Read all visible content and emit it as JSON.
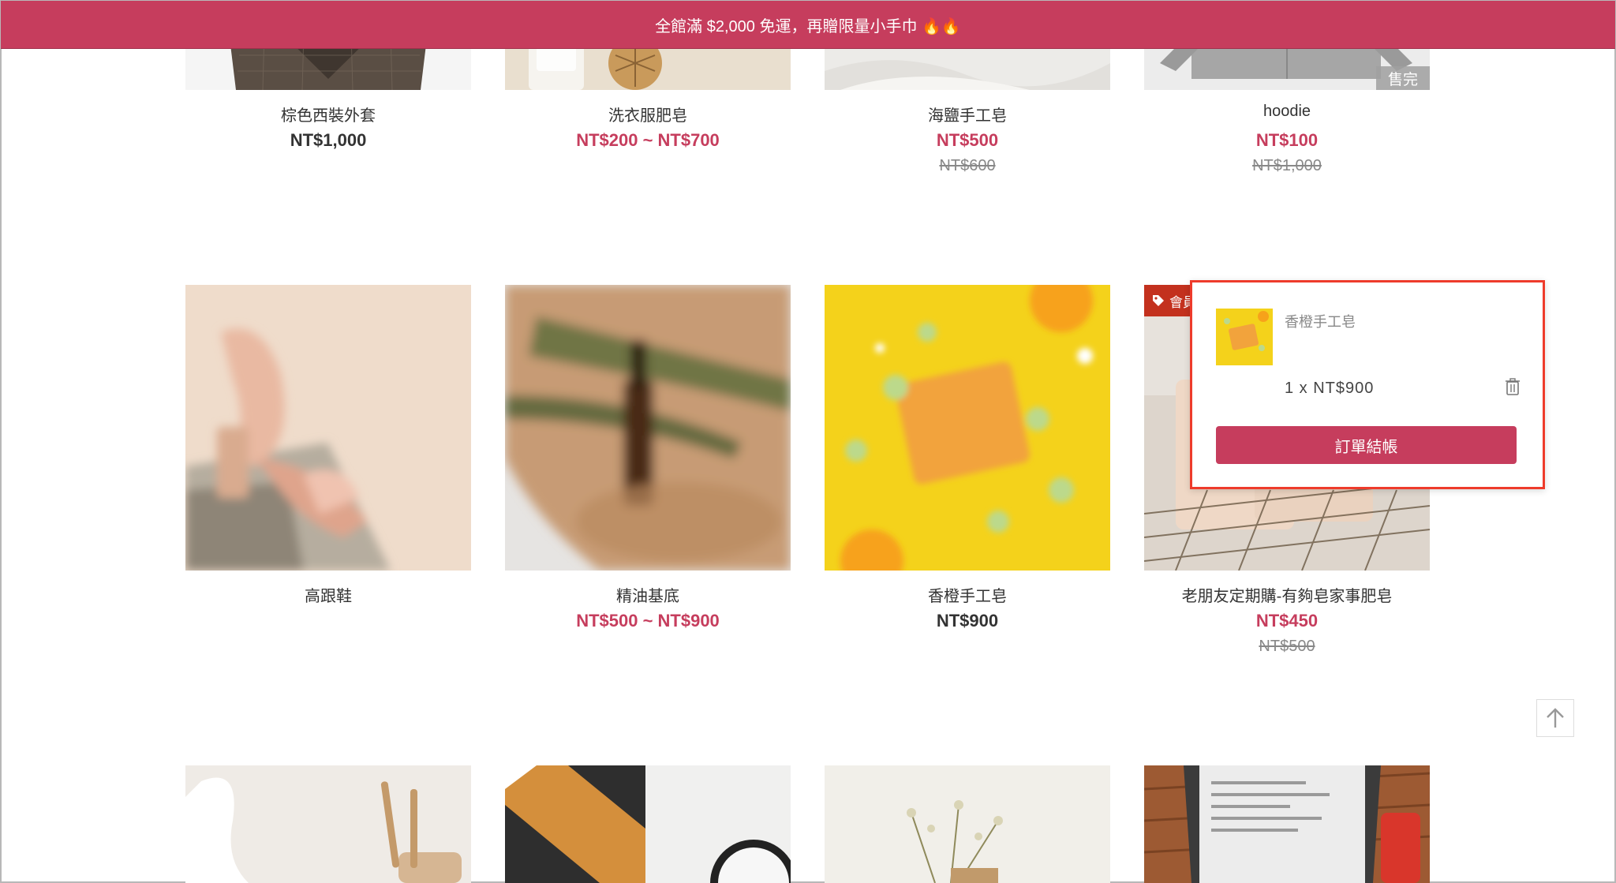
{
  "announcement": "全館滿 $2,000 免運，再贈限量小手巾 🔥🔥",
  "row1": [
    {
      "name": "棕色西裝外套",
      "price": "NT$1,000",
      "orig": ""
    },
    {
      "name": "洗衣服肥皂",
      "price": "NT$200 ~ NT$700",
      "orig": ""
    },
    {
      "name": "海鹽手工皂",
      "price": "NT$500",
      "orig": "NT$600"
    },
    {
      "name": "hoodie",
      "price": "NT$100",
      "orig": "NT$1,000",
      "badge": "售完"
    }
  ],
  "row2": [
    {
      "name": "高跟鞋",
      "price": "",
      "orig": ""
    },
    {
      "name": "精油基底",
      "price": "NT$500 ~ NT$900",
      "orig": ""
    },
    {
      "name": "香橙手工皂",
      "price": "NT$900",
      "orig": ""
    },
    {
      "name": "老朋友定期購-有夠皂家事肥皂",
      "price": "NT$450",
      "orig": "NT$500",
      "badge": "會員"
    }
  ],
  "cart": {
    "item_name": "香橙手工皂",
    "qty_price": "1 x  NT$900",
    "checkout_label": "訂單結帳"
  },
  "colors": {
    "accent": "#c63d5d",
    "highlight": "#ee3b2b"
  },
  "icons": [
    "tag-icon",
    "trash-icon",
    "arrow-up-icon"
  ]
}
